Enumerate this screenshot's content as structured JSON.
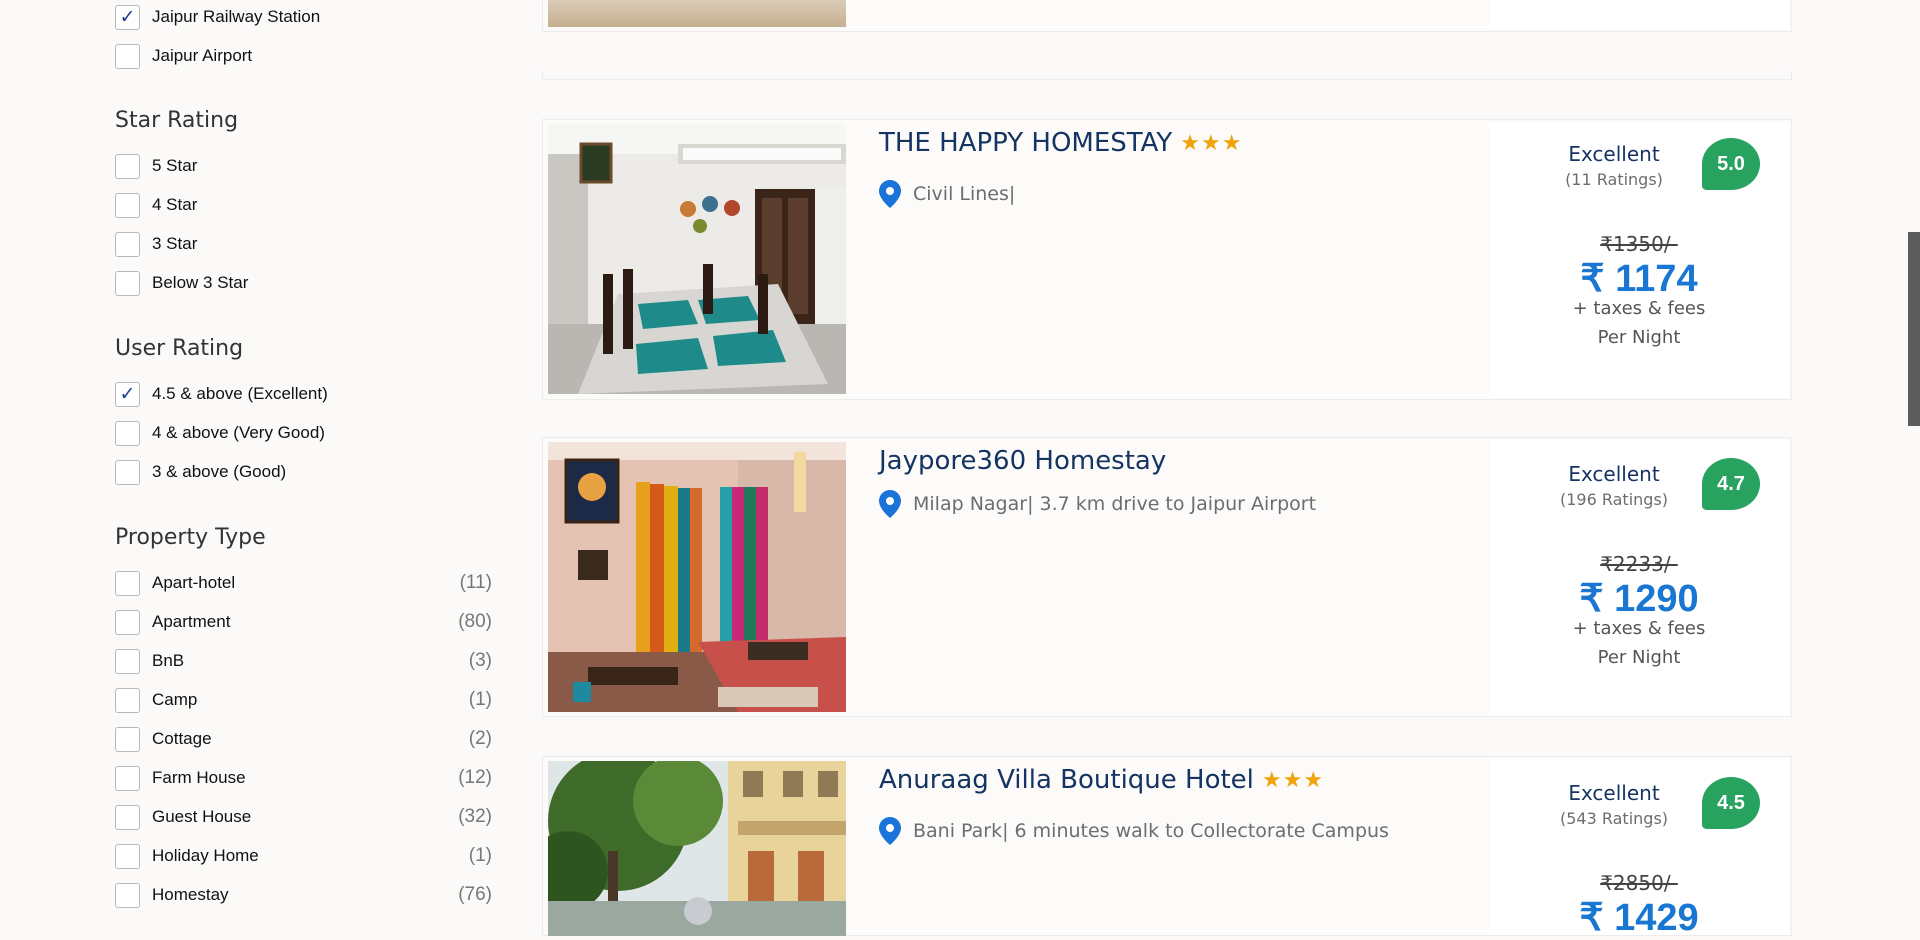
{
  "filters": {
    "locality": [
      {
        "label": "Jaipur Railway Station",
        "checked": true
      },
      {
        "label": "Jaipur Airport",
        "checked": false
      }
    ],
    "star_rating": {
      "title": "Star Rating",
      "options": [
        {
          "label": "5 Star",
          "checked": false
        },
        {
          "label": "4 Star",
          "checked": false
        },
        {
          "label": "3 Star",
          "checked": false
        },
        {
          "label": "Below 3 Star",
          "checked": false
        }
      ]
    },
    "user_rating": {
      "title": "User Rating",
      "options": [
        {
          "label": "4.5 & above (Excellent)",
          "checked": true
        },
        {
          "label": "4 & above (Very Good)",
          "checked": false
        },
        {
          "label": "3 & above (Good)",
          "checked": false
        }
      ]
    },
    "property_type": {
      "title": "Property Type",
      "options": [
        {
          "label": "Apart-hotel",
          "count": "(11)",
          "checked": false
        },
        {
          "label": "Apartment",
          "count": "(80)",
          "checked": false
        },
        {
          "label": "BnB",
          "count": "(3)",
          "checked": false
        },
        {
          "label": "Camp",
          "count": "(1)",
          "checked": false
        },
        {
          "label": "Cottage",
          "count": "(2)",
          "checked": false
        },
        {
          "label": "Farm House",
          "count": "(12)",
          "checked": false
        },
        {
          "label": "Guest House",
          "count": "(32)",
          "checked": false
        },
        {
          "label": "Holiday Home",
          "count": "(1)",
          "checked": false
        },
        {
          "label": "Homestay",
          "count": "(76)",
          "checked": false
        }
      ]
    },
    "check_glyph": "✓"
  },
  "listings": [
    {
      "name": "THE HAPPY HOMESTAY",
      "stars": "★★★",
      "location": "Civil Lines|",
      "rating_word": "Excellent",
      "rating_count": "(11 Ratings)",
      "score": "5.0",
      "old_price": "₹1350/-",
      "price": "₹ 1174",
      "taxes": "+ taxes & fees",
      "per_night": "Per Night"
    },
    {
      "name": "Jaypore360 Homestay",
      "stars": "",
      "location": "Milap Nagar| 3.7 km drive to Jaipur Airport",
      "rating_word": "Excellent",
      "rating_count": "(196 Ratings)",
      "score": "4.7",
      "old_price": "₹2233/-",
      "price": "₹ 1290",
      "taxes": "+ taxes & fees",
      "per_night": "Per Night"
    },
    {
      "name": "Anuraag Villa Boutique Hotel",
      "stars": "★★★",
      "location": "Bani Park| 6 minutes walk to Collectorate Campus",
      "rating_word": "Excellent",
      "rating_count": "(543 Ratings)",
      "score": "4.5",
      "old_price": "₹2850/-",
      "price": "₹ 1429",
      "taxes": "",
      "per_night": ""
    }
  ],
  "colors": {
    "accent": "#1976d2",
    "brand_navy": "#153462",
    "score_green": "#27a25f",
    "star_orange": "#f0a30a"
  }
}
